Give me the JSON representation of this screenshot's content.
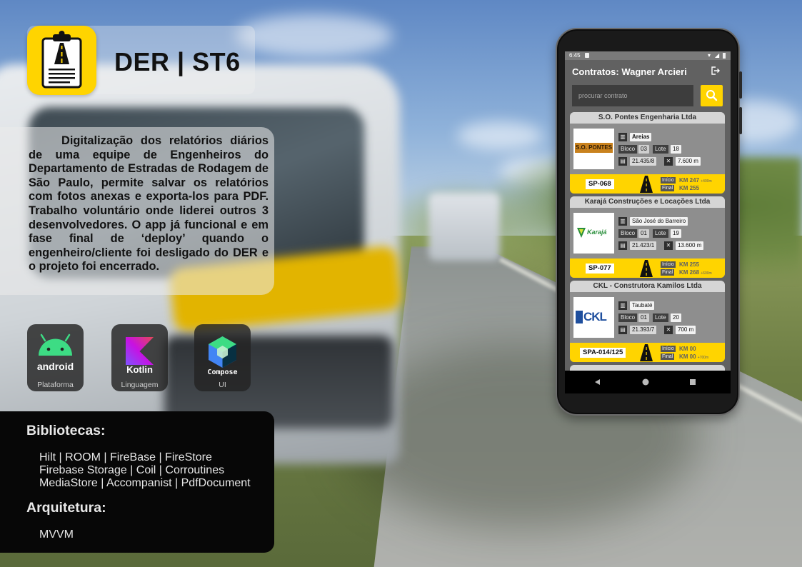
{
  "header": {
    "title": "DER | ST6",
    "icon": "clipboard-road-icon"
  },
  "description": "Digitalização dos relatórios diários de uma equipe de Engenheiros do Departamento de Estradas de Rodagem de São Paulo, permite salvar os relatórios com fotos anexas e exporta-los para PDF. Trabalho voluntário onde liderei outros 3 desenvolvedores. O app já funcional e em fase final de ‘deploy’ quando o engenheiro/cliente foi desligado do DER e o projeto foi encerrado.",
  "tech": [
    {
      "name": "android",
      "caption": "Plataforma",
      "icon": "android-icon"
    },
    {
      "name": "Kotlin",
      "caption": "Linguagem",
      "icon": "kotlin-icon"
    },
    {
      "name": "Compose",
      "caption": "UI",
      "icon": "compose-icon"
    }
  ],
  "libraries": {
    "heading": "Bibliotecas:",
    "lines": [
      "Hilt | ROOM | FireBase | FireStore",
      "Firebase Storage | Coil | Corroutines",
      "MediaStore | Accompanist | PdfDocument"
    ]
  },
  "architecture": {
    "heading": "Arquitetura:",
    "value": "MVVM"
  },
  "phone": {
    "status_time": "6:45",
    "appbar_title": "Contratos: Wagner Arcieri",
    "search_placeholder": "procurar contrato",
    "colors": {
      "accent": "#ffd400",
      "card": "#8e8e8e",
      "screen": "#616161"
    },
    "contracts": [
      {
        "company": "S.O. Pontes Engenharia Ltda",
        "logo_text": "S.O. PONTES",
        "city": "Areias",
        "bloco": "03",
        "lote": "18",
        "doc": "21.435/8",
        "extent": "7.600 m",
        "road": "SP-068",
        "inicio": "KM 247",
        "inicio_extra": "+400m",
        "final": "KM 255",
        "final_extra": ""
      },
      {
        "company": "Karajá Construções e Locações Ltda",
        "logo_text": "Karajá",
        "city": "São José do Barreiro",
        "bloco": "01",
        "lote": "19",
        "doc": "21.423/1",
        "extent": "13.600 m",
        "road": "SP-077",
        "inicio": "KM 255",
        "inicio_extra": "",
        "final": "KM 268",
        "final_extra": "+600m"
      },
      {
        "company": "CKL - Construtora Kamilos Ltda",
        "logo_text": "CKL",
        "city": "Taubaté",
        "bloco": "01",
        "lote": "20",
        "doc": "21.393/7",
        "extent": "700 m",
        "road": "SPA-014/125",
        "inicio": "KM 00",
        "inicio_extra": "",
        "final": "KM 00",
        "final_extra": "+700m"
      }
    ],
    "labels": {
      "bloco": "Bloco",
      "lote": "Lote",
      "inicio": "Início",
      "final": "Final"
    }
  }
}
